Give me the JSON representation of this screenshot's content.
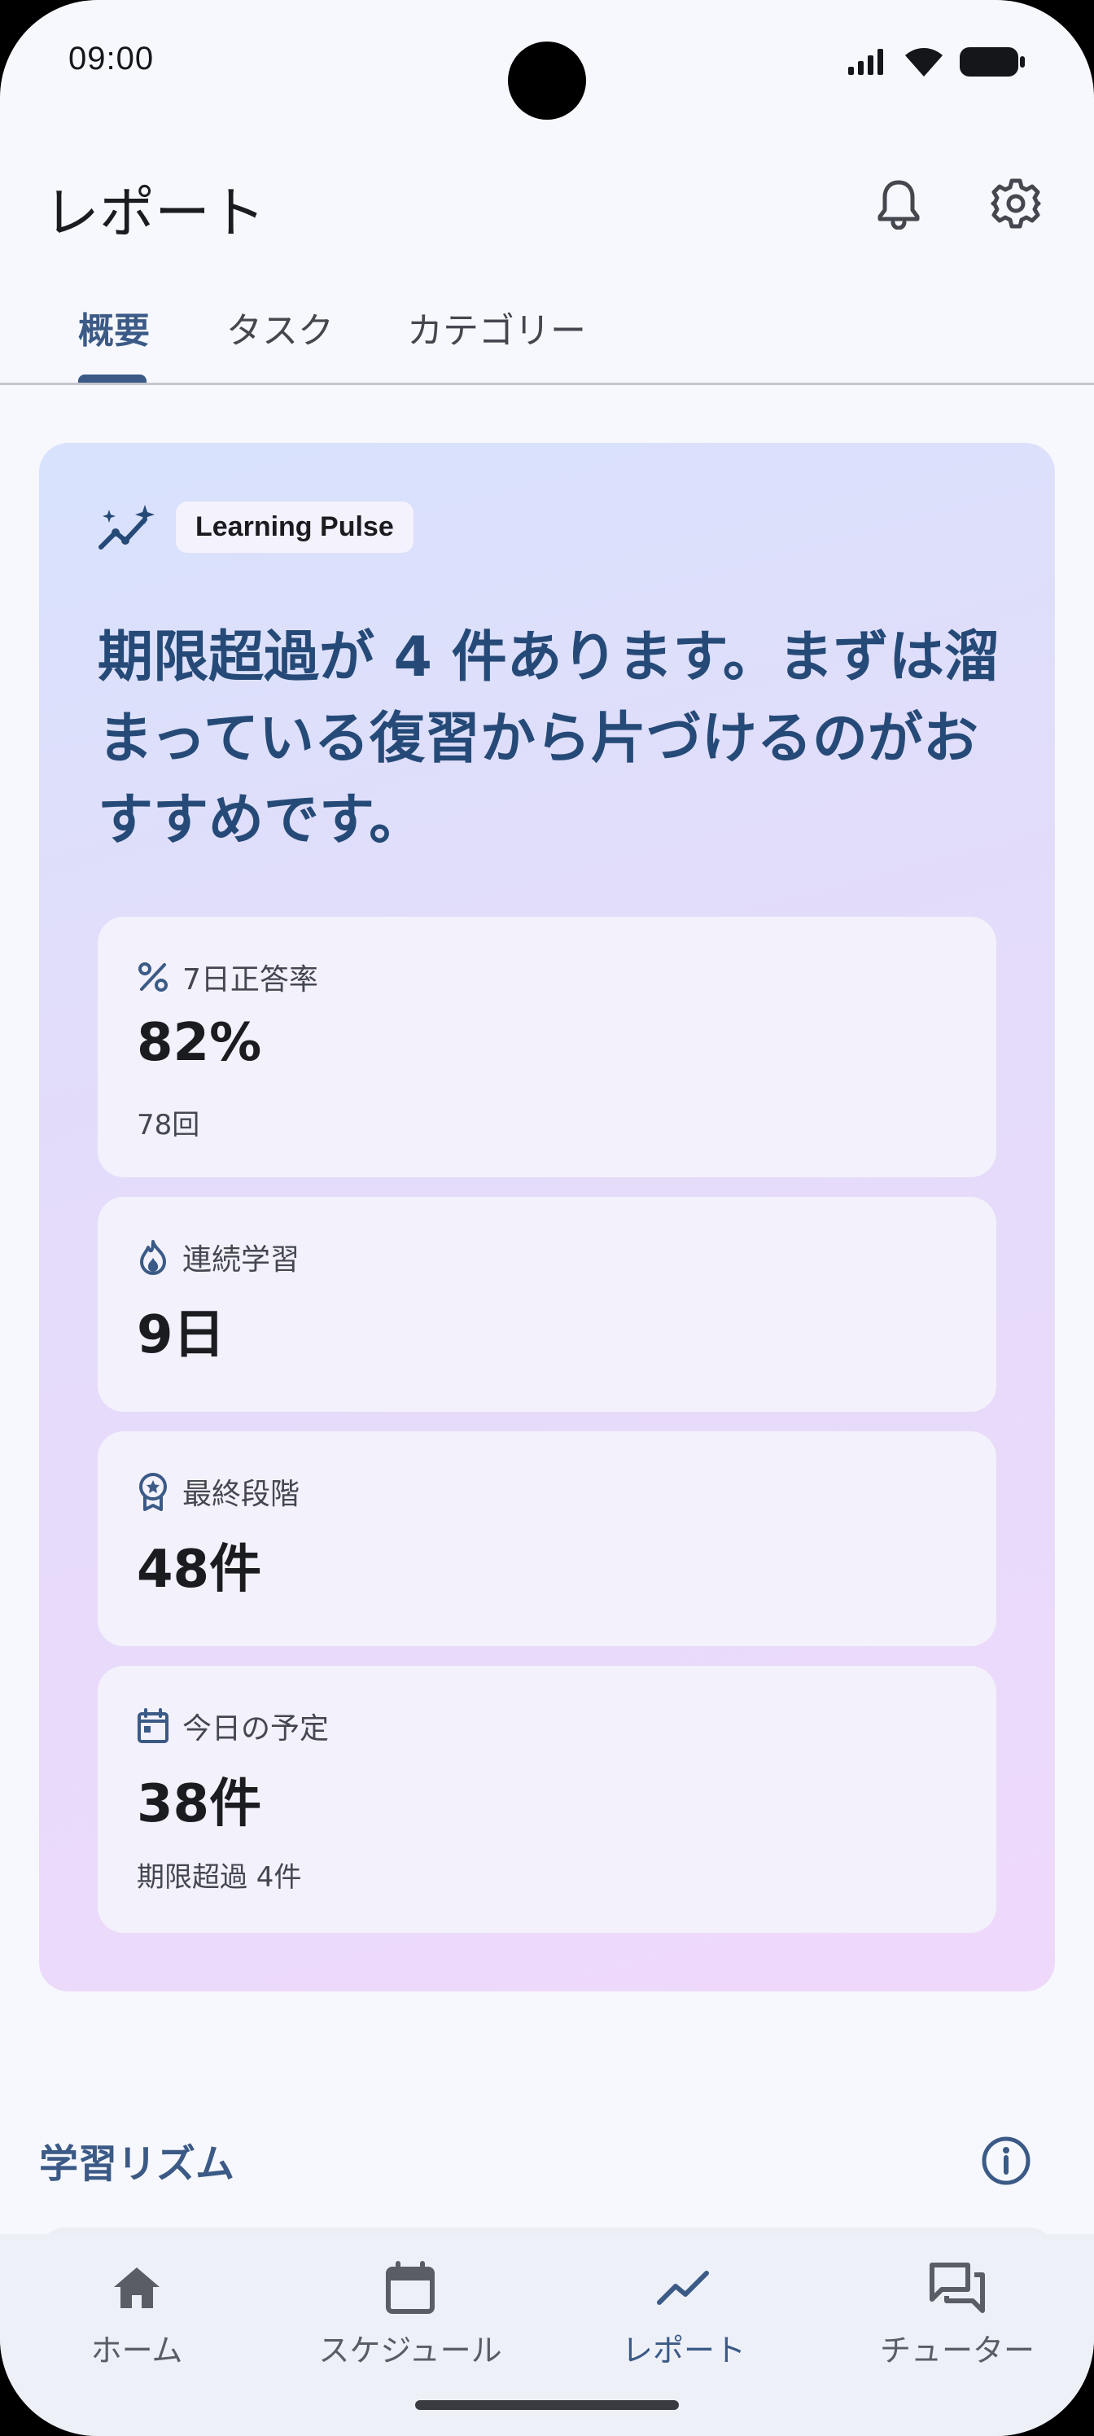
{
  "status_bar": {
    "time": "09:00"
  },
  "app_bar": {
    "title": "レポート",
    "icons": [
      "bell-icon",
      "gear-icon"
    ]
  },
  "tabs": [
    {
      "label": "概要",
      "active": true
    },
    {
      "label": "タスク",
      "active": false
    },
    {
      "label": "カテゴリー",
      "active": false
    }
  ],
  "hero": {
    "chip_label": "Learning Pulse",
    "chip_icon": "sparkle-trend-icon",
    "headline": "期限超過が 4 件あります。まずは溜まっている復習から片づけるのがおすすめです。",
    "stats": [
      {
        "icon": "percent-icon",
        "label": "7日正答率",
        "value": "82%",
        "sub": "78回"
      },
      {
        "icon": "flame-icon",
        "label": "連続学習",
        "value": "9日"
      },
      {
        "icon": "award-icon",
        "label": "最終段階",
        "value": "48件"
      },
      {
        "icon": "calendar-icon",
        "label": "今日の予定",
        "value": "38件",
        "sub": "期限超過 4件"
      }
    ]
  },
  "section": {
    "title": "学習リズム",
    "icon": "info-icon"
  },
  "bottom_nav": [
    {
      "label": "ホーム",
      "icon": "home-icon",
      "active": false
    },
    {
      "label": "スケジュール",
      "icon": "calendar-icon",
      "active": false
    },
    {
      "label": "レポート",
      "icon": "trend-icon",
      "active": true
    },
    {
      "label": "チューター",
      "icon": "chat-icon",
      "active": false
    }
  ],
  "colors": {
    "accent": "#3b5a86",
    "headline": "#264a77",
    "background": "#f7f8fd",
    "hero_gradient_start": "#d8e2fc",
    "hero_gradient_end": "#efd9fb",
    "stat_card": "#f3f1fb"
  }
}
